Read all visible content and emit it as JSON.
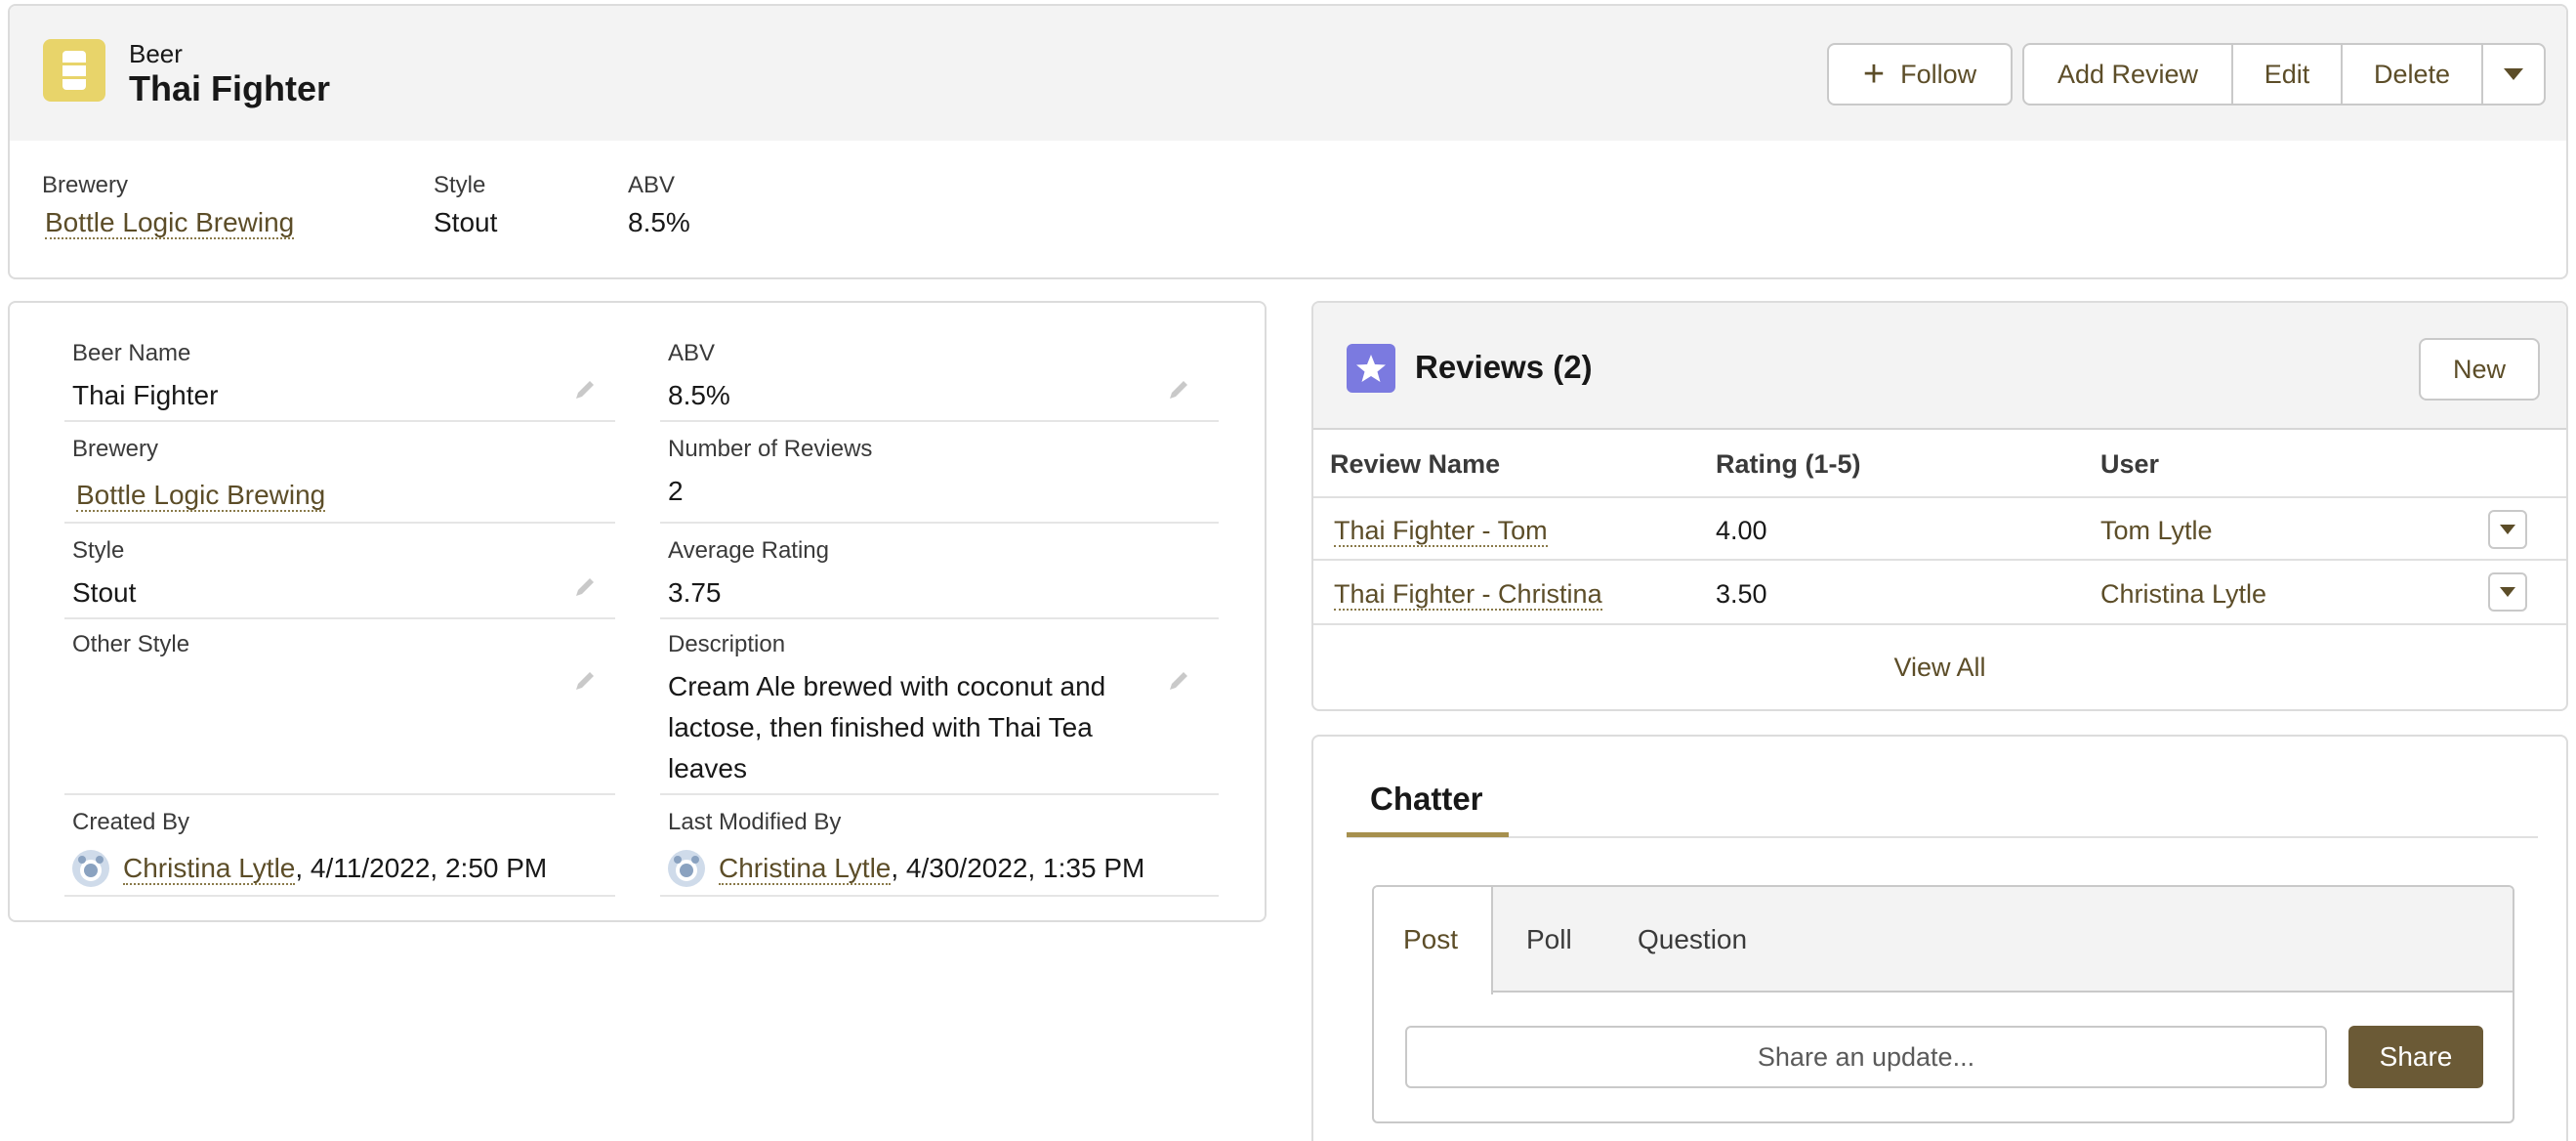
{
  "header": {
    "object_type": "Beer",
    "title": "Thai Fighter",
    "actions": {
      "follow": "Follow",
      "add_review": "Add Review",
      "edit": "Edit",
      "delete": "Delete"
    },
    "highlights": [
      {
        "label": "Brewery",
        "value": "Bottle Logic Brewing"
      },
      {
        "label": "Style",
        "value": "Stout"
      },
      {
        "label": "ABV",
        "value": "8.5%"
      }
    ]
  },
  "details": {
    "beer_name": {
      "label": "Beer Name",
      "value": "Thai Fighter"
    },
    "abv": {
      "label": "ABV",
      "value": "8.5%"
    },
    "brewery": {
      "label": "Brewery",
      "value": "Bottle Logic Brewing"
    },
    "num_reviews": {
      "label": "Number of Reviews",
      "value": "2"
    },
    "style": {
      "label": "Style",
      "value": "Stout"
    },
    "avg_rating": {
      "label": "Average Rating",
      "value": "3.75"
    },
    "other_style": {
      "label": "Other Style",
      "value": ""
    },
    "description": {
      "label": "Description",
      "value": "Cream Ale brewed with coconut and lactose, then finished with Thai Tea leaves"
    },
    "created_by": {
      "label": "Created By",
      "user": "Christina Lytle",
      "date": ", 4/11/2022, 2:50 PM"
    },
    "modified_by": {
      "label": "Last Modified By",
      "user": "Christina Lytle",
      "date": ", 4/30/2022, 1:35 PM"
    }
  },
  "reviews": {
    "title": "Reviews (2)",
    "new_label": "New",
    "columns": [
      "Review Name",
      "Rating (1-5)",
      "User"
    ],
    "rows": [
      {
        "name": "Thai Fighter - Tom",
        "rating": "4.00",
        "user": "Tom Lytle"
      },
      {
        "name": "Thai Fighter - Christina",
        "rating": "3.50",
        "user": "Christina Lytle"
      }
    ],
    "view_all": "View All"
  },
  "chatter": {
    "tab": "Chatter",
    "publisher_tabs": [
      "Post",
      "Poll",
      "Question"
    ],
    "placeholder": "Share an update...",
    "share_label": "Share"
  },
  "colors": {
    "accent": "#6b5a36",
    "link": "#5c4d28",
    "beer_icon_bg": "#e8d46a",
    "review_icon_bg": "#7b7ae0"
  },
  "icons": {
    "object": "beer-can-icon",
    "reviews": "star-icon",
    "edit": "pencil-icon",
    "menu": "chevron-down-icon",
    "follow": "plus-icon"
  }
}
